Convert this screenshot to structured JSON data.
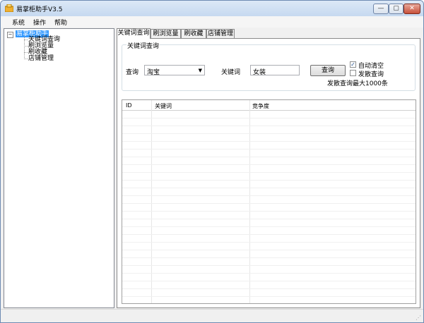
{
  "window": {
    "title": "易掌柜助手V3.5",
    "buttons": {
      "minimize": "—",
      "maximize": "▢",
      "close": "✕"
    }
  },
  "menu": {
    "items": [
      "系统",
      "操作",
      "帮助"
    ]
  },
  "tree": {
    "root": "易掌柜助手",
    "children": [
      "关键词查询",
      "刷浏览量",
      "刷收藏",
      "店铺管理"
    ]
  },
  "tabs": [
    "关键词查询",
    "刷浏览量",
    "刷收藏",
    "店铺管理"
  ],
  "search_group": {
    "title": "关键词查询",
    "query_label": "查询",
    "source_value": "淘宝",
    "keyword_label": "关键词",
    "keyword_value": "女装",
    "search_button": "查询",
    "auto_clear_label": "自动清空",
    "auto_clear_checked": "✓",
    "spread_query_label": "发散查询",
    "note": "发散查询最大1000条"
  },
  "table": {
    "columns": [
      "ID",
      "关键词",
      "竞争度"
    ],
    "rows": []
  },
  "colors": {
    "title_bar": "#c6d9f0",
    "selection": "#3399ff",
    "close_button": "#c7503a"
  }
}
